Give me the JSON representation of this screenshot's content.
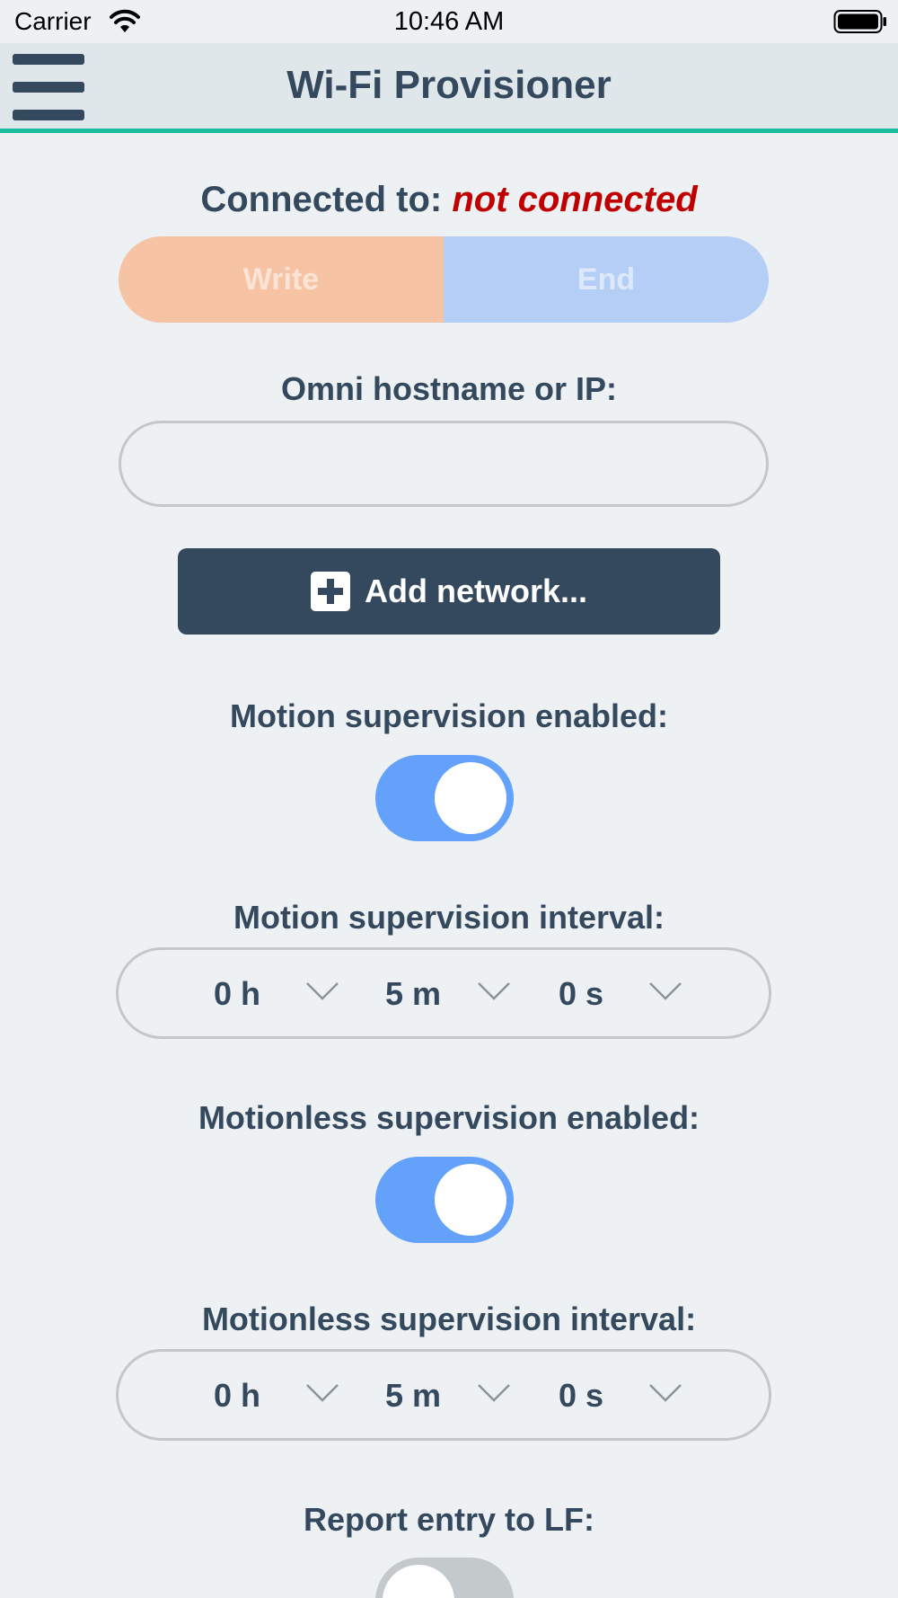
{
  "status_bar": {
    "carrier": "Carrier",
    "time": "10:46 AM"
  },
  "header": {
    "title": "Wi-Fi Provisioner"
  },
  "connection": {
    "label": "Connected to:",
    "status": "not connected",
    "status_color": "#c00000"
  },
  "actions": {
    "write_label": "Write",
    "end_label": "End"
  },
  "host": {
    "label": "Omni hostname or IP:",
    "value": "",
    "placeholder": ""
  },
  "add_network": {
    "label": "Add network..."
  },
  "motion_supervision": {
    "enabled_label": "Motion supervision enabled:",
    "enabled": true,
    "interval_label": "Motion supervision interval:",
    "hours": "0 h",
    "minutes": "5 m",
    "seconds": "0 s"
  },
  "motionless_supervision": {
    "enabled_label": "Motionless supervision enabled:",
    "enabled": true,
    "interval_label": "Motionless supervision interval:",
    "hours": "0 h",
    "minutes": "5 m",
    "seconds": "0 s"
  },
  "report_entry": {
    "label": "Report entry to LF:",
    "enabled": false
  },
  "colors": {
    "accent": "#1abc9c",
    "primary": "#34495e",
    "toggle_on": "#63a1fb",
    "write_bg": "#f6c4a4",
    "end_bg": "#b4cef5"
  }
}
